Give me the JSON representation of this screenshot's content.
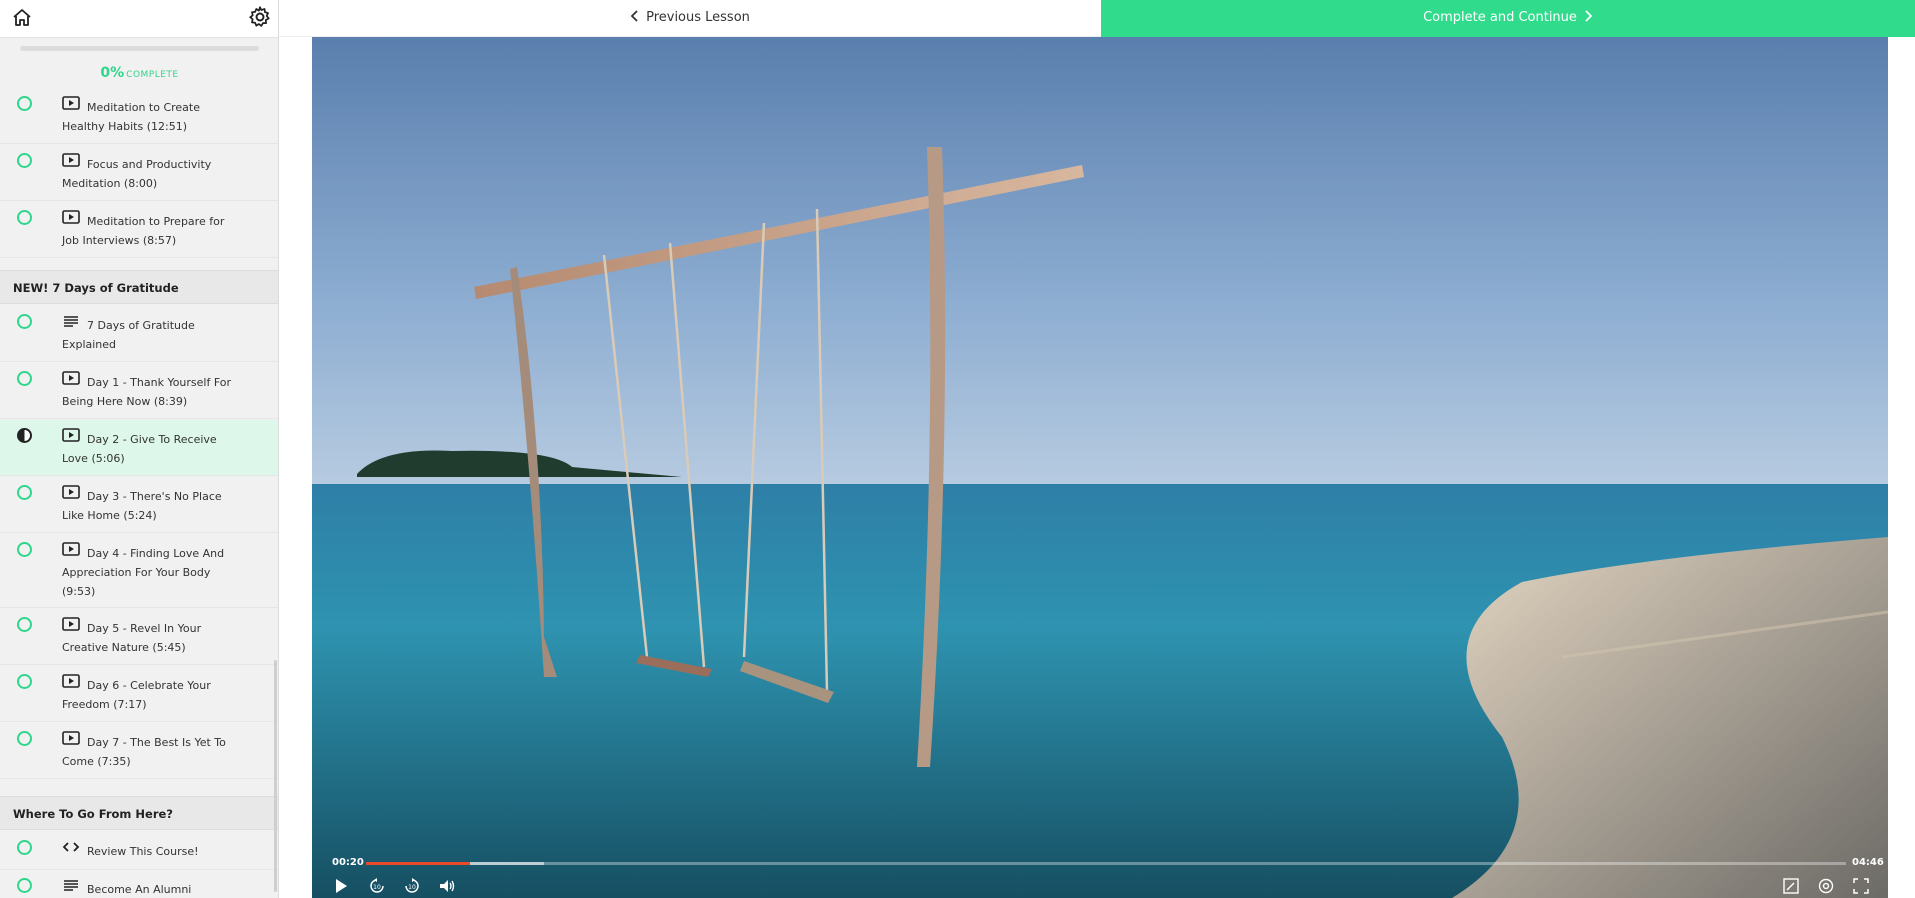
{
  "sidebar": {
    "progress": {
      "percent_text": "0%",
      "word": "COMPLETE",
      "fraction": 0.0
    },
    "lessons_top": [
      {
        "title": "Meditation to Create Healthy Habits (12:51)",
        "type": "video"
      },
      {
        "title": "Focus and Productivity Meditation (8:00)",
        "type": "video"
      },
      {
        "title": "Meditation to Prepare for Job Interviews (8:57)",
        "type": "video"
      }
    ],
    "section1": {
      "title": "NEW! 7 Days of Gratitude"
    },
    "section1_lessons": [
      {
        "title": "7 Days of Gratitude Explained",
        "type": "text"
      },
      {
        "title": "Day 1 - Thank Yourself For Being Here Now (8:39)",
        "type": "video"
      },
      {
        "title": "Day 2 - Give To Receive Love (5:06)",
        "type": "video",
        "active": true
      },
      {
        "title": "Day 3 - There's No Place Like Home (5:24)",
        "type": "video"
      },
      {
        "title": "Day 4 - Finding Love And Appreciation For Your Body (9:53)",
        "type": "video"
      },
      {
        "title": "Day 5 - Revel In Your Creative Nature (5:45)",
        "type": "video"
      },
      {
        "title": "Day 6 - Celebrate Your Freedom (7:17)",
        "type": "video"
      },
      {
        "title": "Day 7 - The Best Is Yet To Come (7:35)",
        "type": "video"
      }
    ],
    "section2": {
      "title": "Where To Go From Here?"
    },
    "section2_lessons": [
      {
        "title": "Review This Course!",
        "type": "code"
      },
      {
        "title": "Become An Alumni",
        "type": "text"
      }
    ]
  },
  "topbar": {
    "prev_label": "Previous Lesson",
    "next_label": "Complete and Continue"
  },
  "player": {
    "current_time": "00:20",
    "duration": "04:46",
    "played_fraction": 0.07,
    "buffered_fraction": 0.12
  },
  "colors": {
    "accent": "#30db8c",
    "seek_played": "#e84a2a"
  },
  "icons": [
    "home-icon",
    "gear-icon",
    "chevron-left-icon",
    "chevron-right-icon",
    "play-icon",
    "rewind-10-icon",
    "forward-10-icon",
    "volume-icon",
    "notes-icon",
    "settings-icon",
    "fullscreen-icon"
  ]
}
